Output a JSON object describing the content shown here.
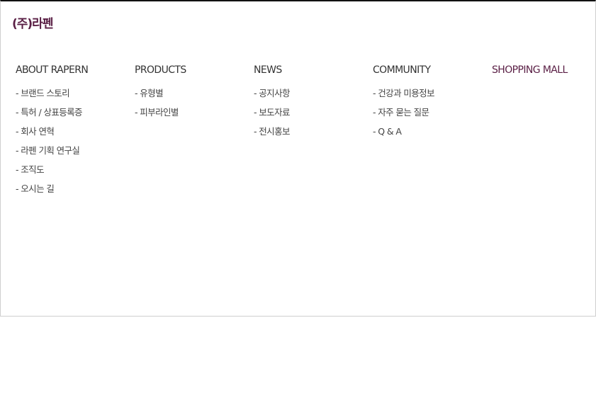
{
  "brand": {
    "name": "(주)라펜",
    "color": "#5a1f45"
  },
  "menu": [
    {
      "key": "about",
      "heading": "ABOUT RAPERN",
      "highlight": false,
      "items": [
        "- 브랜드 스토리",
        "- 특허 / 상표등록증",
        "- 회사 연혁",
        "- 라펜 기획 연구실",
        "- 조직도",
        "- 오시는 길"
      ]
    },
    {
      "key": "products",
      "heading": "PRODUCTS",
      "highlight": false,
      "items": [
        "- 유형별",
        "- 피부라인별"
      ]
    },
    {
      "key": "news",
      "heading": "NEWS",
      "highlight": false,
      "items": [
        "- 공지사항",
        "- 보도자료",
        "- 전시홍보"
      ]
    },
    {
      "key": "community",
      "heading": "COMMUNITY",
      "highlight": false,
      "items": [
        "- 건강과 미용정보",
        "- 자주 묻는 질문",
        "- Q & A"
      ]
    },
    {
      "key": "shopping",
      "heading": "SHOPPING MALL",
      "highlight": true,
      "items": []
    }
  ]
}
